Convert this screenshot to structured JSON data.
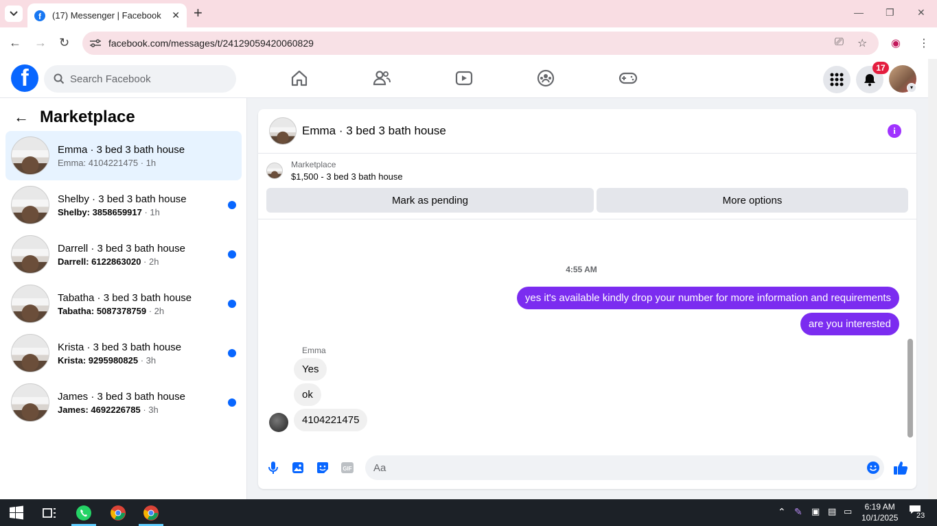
{
  "browser": {
    "tab_title": "(17) Messenger | Facebook",
    "url": "facebook.com/messages/t/24129059420060829"
  },
  "fb": {
    "search_placeholder": "Search Facebook",
    "notification_count": "17"
  },
  "sidebar": {
    "title": "Marketplace",
    "conversations": [
      {
        "name": "Emma · 3 bed 3 bath house",
        "sub": "Emma: 4104221475",
        "time": " · 1h",
        "unread": false,
        "active": true
      },
      {
        "name": "Shelby · 3 bed 3 bath house",
        "sub": "Shelby: 3858659917",
        "time": " · 1h",
        "unread": true,
        "active": false
      },
      {
        "name": "Darrell · 3 bed 3 bath house",
        "sub": "Darrell: 6122863020",
        "time": " · 2h",
        "unread": true,
        "active": false
      },
      {
        "name": "Tabatha · 3 bed 3 bath house",
        "sub": "Tabatha: 5087378759",
        "time": " · 2h",
        "unread": true,
        "active": false
      },
      {
        "name": "Krista · 3 bed 3 bath house",
        "sub": "Krista: 9295980825",
        "time": " · 3h",
        "unread": true,
        "active": false
      },
      {
        "name": "James · 3 bed 3 bath house",
        "sub": "James: 4692226785",
        "time": " · 3h",
        "unread": true,
        "active": false
      }
    ]
  },
  "chat": {
    "title": "Emma · 3 bed 3 bath house",
    "listing_label": "Marketplace",
    "listing_title": "$1,500 - 3 bed 3 bath house",
    "mark_pending": "Mark as pending",
    "more_options": "More options",
    "timestamp": "4:55 AM",
    "outgoing": [
      "yes it's available kindly drop your number for more information and requirements",
      "are you interested"
    ],
    "sender_name": "Emma",
    "incoming": [
      "Yes",
      "ok",
      "4104221475"
    ],
    "composer_placeholder": "Aa"
  },
  "taskbar": {
    "time": "6:19 AM",
    "date": "10/1/2025",
    "notifications": "23"
  },
  "colors": {
    "fb_blue": "#0866ff",
    "outgoing_bubble": "#7b2cf0",
    "badge_red": "#e41e3f"
  }
}
